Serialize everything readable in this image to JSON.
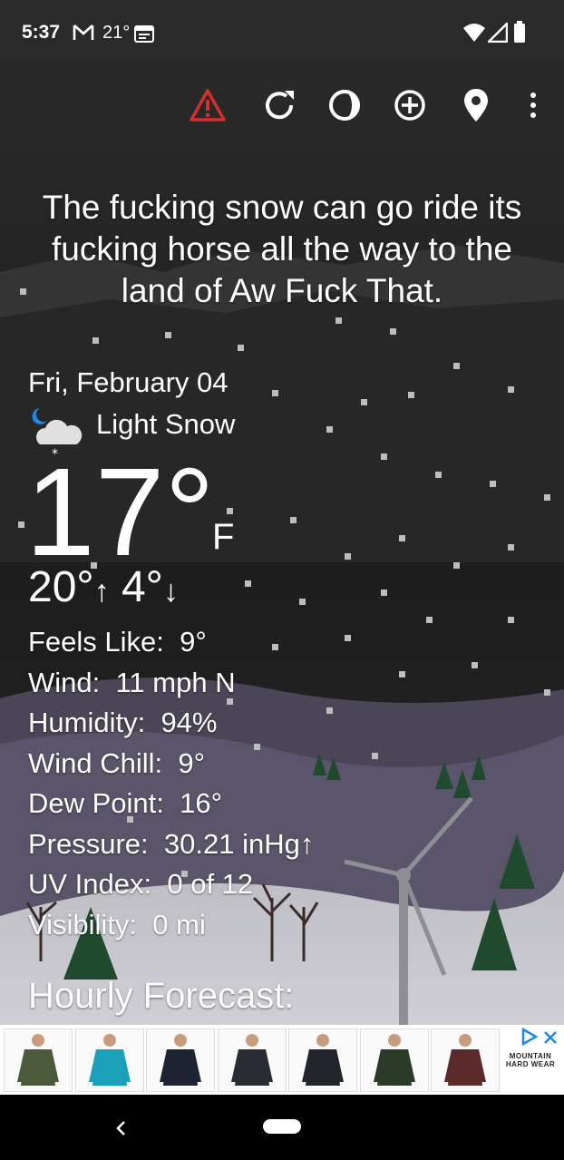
{
  "status_bar": {
    "time": "5:37",
    "temperature": "21°"
  },
  "action_bar": {
    "icons": [
      "alert-icon",
      "refresh-icon",
      "theme-icon",
      "add-location-icon",
      "location-pin-icon",
      "more-vert-icon"
    ]
  },
  "headline": "The fucking snow can go ride its fucking horse all the way to the land of Aw Fuck That.",
  "current": {
    "date": "Fri, February 04",
    "condition": "Light Snow",
    "temperature": "17°",
    "unit": "F",
    "high": "20°",
    "high_arrow": "↑",
    "low": "4°",
    "low_arrow": "↓"
  },
  "stats": [
    {
      "label": "Feels Like:",
      "value": "9°"
    },
    {
      "label": "Wind:",
      "value": "11 mph N"
    },
    {
      "label": "Humidity:",
      "value": "94%"
    },
    {
      "label": "Wind Chill:",
      "value": "9°"
    },
    {
      "label": "Dew Point:",
      "value": "16°"
    },
    {
      "label": "Pressure:",
      "value": "30.21 inHg↑"
    },
    {
      "label": "UV Index:",
      "value": "0 of 12"
    },
    {
      "label": "Visibility:",
      "value": "0 mi"
    }
  ],
  "hourly_title": "Hourly Forecast:",
  "ad": {
    "brand": "MOUNTAIN HARD WEAR",
    "jacket_colors": [
      "#4a5a3a",
      "#1aa0b8",
      "#1d2330",
      "#2a2c33",
      "#23252c",
      "#2c3a28",
      "#5a2a2a"
    ]
  },
  "colors": {
    "alert": "#d32f2f",
    "background": "#1f1f1f",
    "accent_ad": "#1e88e5"
  }
}
